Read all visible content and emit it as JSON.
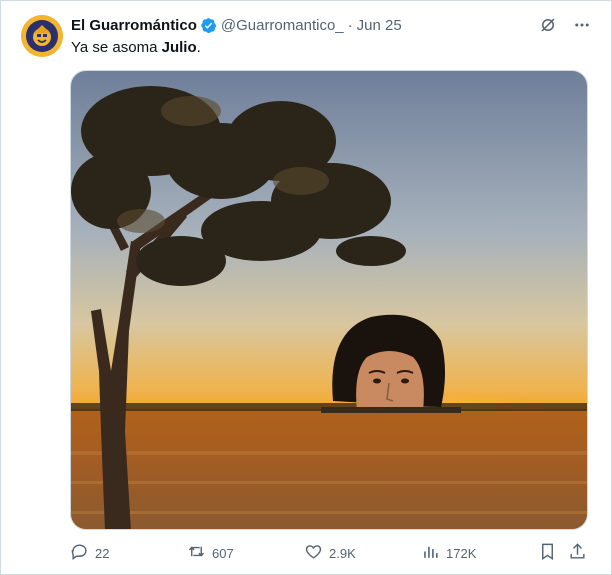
{
  "tweet": {
    "author": {
      "display_name": "El Guarromántico",
      "verified": true,
      "handle": "@Guarromantico_",
      "avatar_icon": "profile-avatar"
    },
    "separator": "·",
    "date": "Jun 25",
    "text_before": "Ya se asoma ",
    "text_bold": "Julio",
    "text_after": ".",
    "media": {
      "description_icon": "photo-sunset-field-tree-face"
    }
  },
  "top_actions": {
    "grok_icon": "grok-icon",
    "more_icon": "more-dots-icon"
  },
  "actions": {
    "reply": {
      "icon": "reply-icon",
      "count": "22"
    },
    "retweet": {
      "icon": "retweet-icon",
      "count": "607"
    },
    "like": {
      "icon": "heart-icon",
      "count": "2.9K"
    },
    "views": {
      "icon": "analytics-icon",
      "count": "172K"
    },
    "bookmark": {
      "icon": "bookmark-icon"
    },
    "share": {
      "icon": "share-icon"
    }
  },
  "colors": {
    "text_primary": "#0f1419",
    "text_secondary": "#536471",
    "verified_blue": "#1d9bf0",
    "border": "#cfd9de"
  }
}
